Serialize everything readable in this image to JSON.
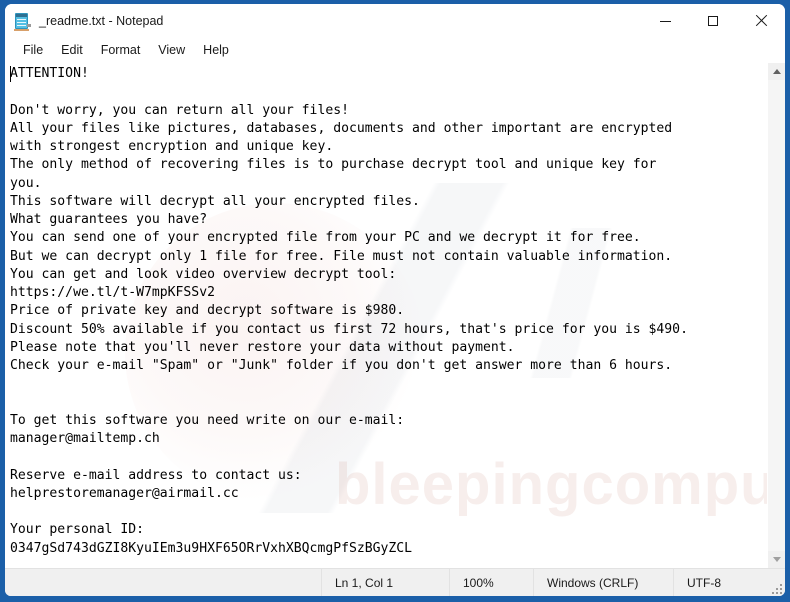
{
  "window": {
    "title": "_readme.txt - Notepad",
    "icon": "notepad-icon",
    "frame_color": "#1b5fa8",
    "controls": {
      "minimize": "minimize-icon",
      "maximize": "maximize-icon",
      "close": "close-icon"
    }
  },
  "menubar": {
    "items": [
      {
        "label": "File"
      },
      {
        "label": "Edit"
      },
      {
        "label": "Format"
      },
      {
        "label": "View"
      },
      {
        "label": "Help"
      }
    ]
  },
  "editor": {
    "content": "ATTENTION!\n\nDon't worry, you can return all your files!\nAll your files like pictures, databases, documents and other important are encrypted\nwith strongest encryption and unique key.\nThe only method of recovering files is to purchase decrypt tool and unique key for\nyou.\nThis software will decrypt all your encrypted files.\nWhat guarantees you have?\nYou can send one of your encrypted file from your PC and we decrypt it for free.\nBut we can decrypt only 1 file for free. File must not contain valuable information.\nYou can get and look video overview decrypt tool:\nhttps://we.tl/t-W7mpKFSSv2\nPrice of private key and decrypt software is $980.\nDiscount 50% available if you contact us first 72 hours, that's price for you is $490.\nPlease note that you'll never restore your data without payment.\nCheck your e-mail \"Spam\" or \"Junk\" folder if you don't get answer more than 6 hours.\n\n\nTo get this software you need write on our e-mail:\nmanager@mailtemp.ch\n\nReserve e-mail address to contact us:\nhelprestoremanager@airmail.cc\n\nYour personal ID:\n0347gSd743dGZI8KyuIEm3u9HXF65ORrVxhXBQcmgPfSzBGyZCL",
    "watermark": "bleepingcomputer.com",
    "scrollbar": {
      "up_arrow": "scroll-up-icon",
      "down_arrow": "scroll-down-icon"
    }
  },
  "statusbar": {
    "position": "Ln 1, Col 1",
    "zoom": "100%",
    "line_ending": "Windows (CRLF)",
    "encoding": "UTF-8"
  }
}
